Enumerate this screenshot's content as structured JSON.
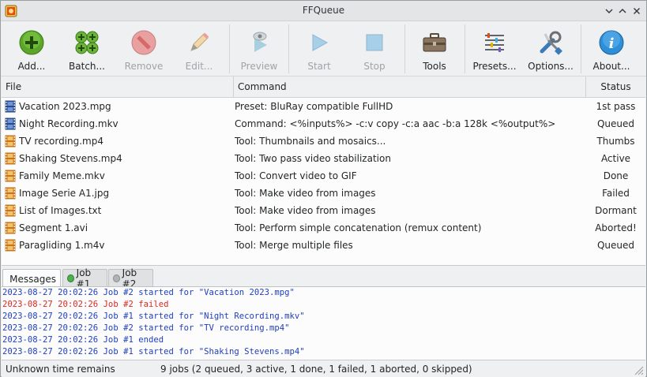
{
  "window": {
    "title": "FFQueue"
  },
  "toolbar": {
    "buttons": [
      {
        "label": "Add...",
        "icon": "add-plus-icon",
        "enabled": true
      },
      {
        "label": "Batch...",
        "icon": "batch-add-icon",
        "enabled": true
      },
      {
        "label": "Remove",
        "icon": "remove-icon",
        "enabled": false
      },
      {
        "label": "Edit...",
        "icon": "pencil-icon",
        "enabled": false
      },
      {
        "label": "Preview",
        "icon": "preview-eye-icon",
        "enabled": false
      },
      {
        "label": "Start",
        "icon": "play-icon",
        "enabled": false
      },
      {
        "label": "Stop",
        "icon": "stop-icon",
        "enabled": false
      },
      {
        "label": "Tools",
        "icon": "toolbox-icon",
        "enabled": true
      },
      {
        "label": "Presets...",
        "icon": "sliders-icon",
        "enabled": true
      },
      {
        "label": "Options...",
        "icon": "wrench-screwdriver-icon",
        "enabled": true
      },
      {
        "label": "About...",
        "icon": "info-icon",
        "enabled": true
      }
    ]
  },
  "table": {
    "headers": {
      "file": "File",
      "command": "Command",
      "status": "Status"
    },
    "rows": [
      {
        "file": "Vacation 2023.mpg",
        "command": "Preset: BluRay compatible FullHD",
        "status": "1st pass",
        "icon": "film-blue-icon"
      },
      {
        "file": "Night Recording.mkv",
        "command": "Command: <%inputs%> -c:v copy -c:a aac -b:a 128k <%output%>",
        "status": "Queued",
        "icon": "film-blue-icon"
      },
      {
        "file": "TV recording.mp4",
        "command": "Tool: Thumbnails and mosaics...",
        "status": "Thumbs",
        "icon": "film-orange-icon"
      },
      {
        "file": "Shaking Stevens.mp4",
        "command": "Tool: Two pass video stabilization",
        "status": "Active",
        "icon": "film-orange-icon"
      },
      {
        "file": "Family Meme.mkv",
        "command": "Tool: Convert video to GIF",
        "status": "Done",
        "icon": "film-orange-icon"
      },
      {
        "file": "Image Serie A1.jpg",
        "command": "Tool: Make video from images",
        "status": "Failed",
        "icon": "film-orange-icon"
      },
      {
        "file": "List of Images.txt",
        "command": "Tool: Make video from images",
        "status": "Dormant",
        "icon": "film-orange-icon"
      },
      {
        "file": "Segment 1.avi",
        "command": "Tool: Perform simple concatenation (remux content)",
        "status": "Aborted!",
        "icon": "film-orange-icon"
      },
      {
        "file": "Paragliding 1.m4v",
        "command": "Tool: Merge multiple files",
        "status": "Queued",
        "icon": "film-orange-icon"
      }
    ]
  },
  "tabs": [
    {
      "label": "Messages",
      "icon": "document-icon",
      "active": true
    },
    {
      "label": "Job #1",
      "icon": "green-dot-icon",
      "active": false
    },
    {
      "label": "Job #2",
      "icon": "grey-dot-icon",
      "active": false
    }
  ],
  "log": [
    {
      "text": "2023-08-27 20:02:26 Job #2 started for \"Vacation 2023.mpg\"",
      "color": "#1f3fbf"
    },
    {
      "text": "2023-08-27 20:02:26 Job #2 failed",
      "color": "#e0261e"
    },
    {
      "text": "2023-08-27 20:02:26 Job #1 started for \"Night Recording.mkv\"",
      "color": "#1f3fbf"
    },
    {
      "text": "2023-08-27 20:02:26 Job #2 started for \"TV recording.mp4\"",
      "color": "#1f3fbf"
    },
    {
      "text": "2023-08-27 20:02:26 Job #1 ended",
      "color": "#1f3fbf"
    },
    {
      "text": "2023-08-27 20:02:26 Job #1 started for \"Shaking Stevens.mp4\"",
      "color": "#1f3fbf"
    }
  ],
  "statusbar": {
    "time": "Unknown time remains",
    "summary": "9 jobs (2 queued, 3 active, 1 done, 1 failed, 1 aborted, 0 skipped)"
  }
}
